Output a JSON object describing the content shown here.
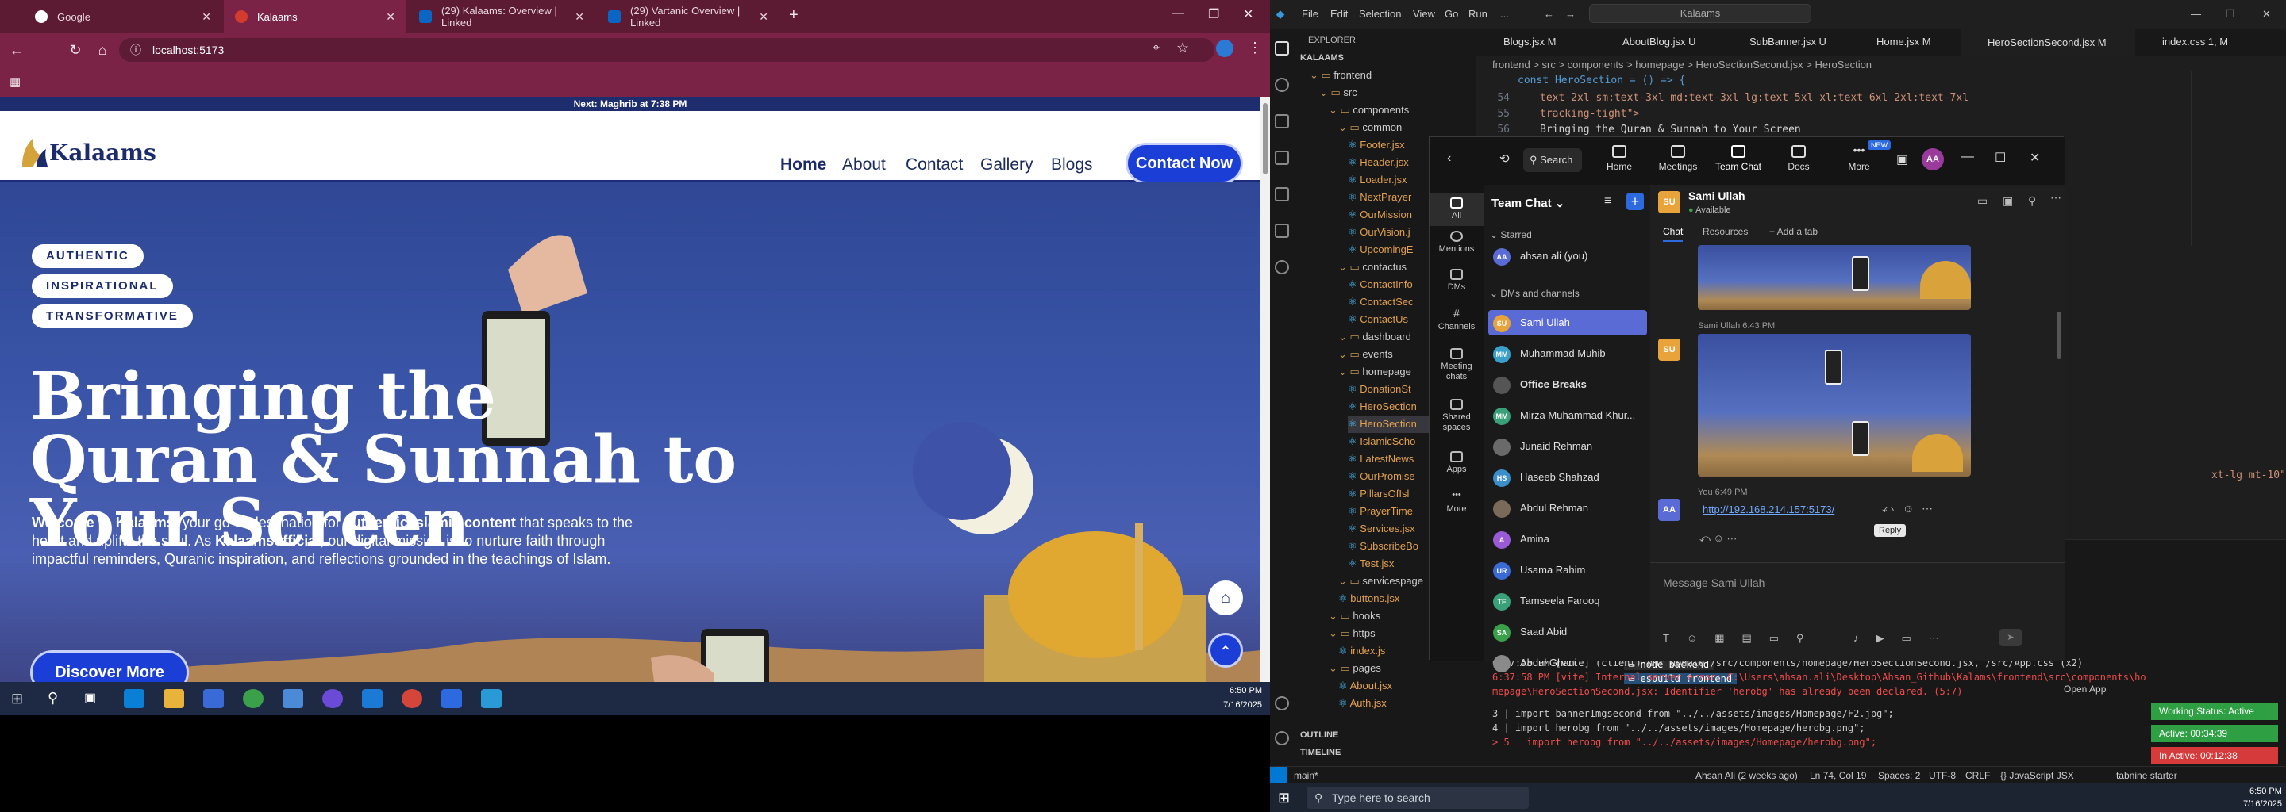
{
  "browser": {
    "tabs": [
      {
        "title": "Google",
        "color": "#ffffff"
      },
      {
        "title": "Kalaams",
        "color": "#d33b2c"
      },
      {
        "title": "(29) Kalaams: Overview | Linked",
        "color": "#0a66c2"
      },
      {
        "title": "(29) Vartanic Overview | Linked",
        "color": "#0a66c2"
      }
    ],
    "url": "localhost:5173",
    "taskbar_time": "6:50 PM",
    "taskbar_date": "7/16/2025"
  },
  "site": {
    "prayer_banner": "Next: Maghrib at 7:38 PM",
    "logo": "Kalaams",
    "nav": [
      "Home",
      "About",
      "Contact",
      "Gallery",
      "Blogs"
    ],
    "cta": "Contact Now",
    "pills": [
      "AUTHENTIC",
      "INSPIRATIONAL",
      "TRANSFORMATIVE"
    ],
    "hero_title": "Bringing the Quran & Sunnah to Your Screen",
    "hero_desc_1": "Welcome to Kalaams",
    "hero_desc_2": ", your go-to destination for ",
    "hero_desc_3": "authentic Islamic content",
    "hero_desc_4": " that speaks to the heart and uplifts the soul. As ",
    "hero_desc_5": "Kalaamsofficial",
    "hero_desc_6": ", our digital mission is to nurture faith through impactful reminders, Quranic inspiration, and reflections grounded in the teachings of Islam.",
    "discover": "Discover More"
  },
  "vscode": {
    "menu": [
      "File",
      "Edit",
      "Selection",
      "View",
      "Go",
      "Run",
      "..."
    ],
    "search": "Kalaams",
    "explorer_title": "EXPLORER",
    "root": "KALAAMS",
    "tree": [
      {
        "name": "frontend",
        "type": "dir",
        "indent": 1
      },
      {
        "name": "src",
        "type": "dir",
        "indent": 2
      },
      {
        "name": "components",
        "type": "dir",
        "indent": 3
      },
      {
        "name": "common",
        "type": "dir",
        "indent": 4
      },
      {
        "name": "Footer.jsx",
        "type": "file",
        "indent": 5
      },
      {
        "name": "Header.jsx",
        "type": "file",
        "indent": 5
      },
      {
        "name": "Loader.jsx",
        "type": "file",
        "indent": 5
      },
      {
        "name": "NextPrayer",
        "type": "file",
        "indent": 5
      },
      {
        "name": "OurMission",
        "type": "file",
        "indent": 5
      },
      {
        "name": "OurVision.j",
        "type": "file",
        "indent": 5
      },
      {
        "name": "UpcomingE",
        "type": "file",
        "indent": 5
      },
      {
        "name": "contactus",
        "type": "dir",
        "indent": 4
      },
      {
        "name": "ContactInfo",
        "type": "file",
        "indent": 5
      },
      {
        "name": "ContactSec",
        "type": "file",
        "indent": 5
      },
      {
        "name": "ContactUs",
        "type": "file",
        "indent": 5
      },
      {
        "name": "dashboard",
        "type": "dir",
        "indent": 4
      },
      {
        "name": "events",
        "type": "dir",
        "indent": 4
      },
      {
        "name": "homepage",
        "type": "dir",
        "indent": 4
      },
      {
        "name": "DonationSt",
        "type": "file",
        "indent": 5
      },
      {
        "name": "HeroSection",
        "type": "file",
        "indent": 5
      },
      {
        "name": "HeroSection",
        "type": "file",
        "indent": 5
      },
      {
        "name": "IslamicScho",
        "type": "file",
        "indent": 5
      },
      {
        "name": "LatestNews",
        "type": "file",
        "indent": 5
      },
      {
        "name": "OurPromise",
        "type": "file",
        "indent": 5
      },
      {
        "name": "PillarsOfIsl",
        "type": "file",
        "indent": 5
      },
      {
        "name": "PrayerTime",
        "type": "file",
        "indent": 5
      },
      {
        "name": "Services.jsx",
        "type": "file",
        "indent": 5
      },
      {
        "name": "SubscribeBo",
        "type": "file",
        "indent": 5
      },
      {
        "name": "Test.jsx",
        "type": "file",
        "indent": 5
      },
      {
        "name": "servicespage",
        "type": "dir",
        "indent": 4
      },
      {
        "name": "buttons.jsx",
        "type": "file",
        "indent": 4
      },
      {
        "name": "hooks",
        "type": "dir",
        "indent": 3
      },
      {
        "name": "https",
        "type": "dir",
        "indent": 3
      },
      {
        "name": "index.js",
        "type": "file",
        "indent": 4
      },
      {
        "name": "pages",
        "type": "dir",
        "indent": 3
      },
      {
        "name": "About.jsx",
        "type": "file",
        "indent": 4
      },
      {
        "name": "Auth.jsx",
        "type": "file",
        "indent": 4
      }
    ],
    "outline": "OUTLINE",
    "timeline": "TIMELINE",
    "editor_tabs": [
      "Blogs.jsx M",
      "AboutBlog.jsx U",
      "SubBanner.jsx U",
      "Home.jsx M",
      "HeroSectionSecond.jsx M",
      "index.css 1, M"
    ],
    "breadcrumb": "frontend > src > components > homepage > HeroSectionSecond.jsx > HeroSection",
    "code_sticky": "const HeroSection = () => {",
    "code_lines": [
      {
        "n": "54",
        "t": "text-2xl sm:text-3xl md:text-3xl lg:text-5xl xl:text-6xl 2xl:text-7xl"
      },
      {
        "n": "55",
        "t": "  tracking-tight\">"
      },
      {
        "n": "56",
        "t": "  Bringing the Quran & Sunnah to Your Screen"
      }
    ],
    "code_fragment": "xt-lg mt-10\"",
    "terminal": [
      {
        "t": "6:37:58 PM [vite] (client) hmr update /src/components/homepage/HeroSectionSecond.jsx, /src/App.css (x2)",
        "c": "#cccccc"
      },
      {
        "t": "6:37:58 PM [vite] Internal server error: C:\\Users\\ahsan.ali\\Desktop\\Ahsan_Github\\Kalams\\frontend\\src\\components\\ho",
        "c": "#f14c4c"
      },
      {
        "t": "mepage\\HeroSectionSecond.jsx: Identifier 'herobg' has already been declared. (5:7)",
        "c": "#f14c4c"
      },
      {
        "t": "  3 | import bannerImgsecond from \"../../assets/images/Homepage/F2.jpg\";",
        "c": "#cccccc"
      },
      {
        "t": "  4 | import herobg from \"../../assets/images/Homepage/herobg.png\";",
        "c": "#cccccc"
      },
      {
        "t": "> 5 | import herobg from \"../../assets/images/Homepage/herobg.png\";",
        "c": "#f14c4c"
      }
    ],
    "term_tabs": [
      "node backend",
      "esbuild frontend"
    ],
    "open_app": "Open App",
    "working_status": "Working Status: Active",
    "active_time": "Active: 00:34:39",
    "inactive_time": "In Active: 00:12:38",
    "status_left": "main*",
    "status_items": [
      "Ahsan Ali (2 weeks ago)",
      "Ln 74, Col 19",
      "Spaces: 2",
      "UTF-8",
      "CRLF",
      "{} JavaScript JSX",
      "tabnine starter"
    ],
    "taskbar_search": "Type here to search",
    "taskbar_time": "6:50 PM",
    "taskbar_date": "7/16/2025"
  },
  "teams": {
    "top_search": "Search",
    "top_nav": [
      "Home",
      "Meetings",
      "Team Chat",
      "Docs",
      "More"
    ],
    "new_badge": "NEW",
    "rail": [
      "All",
      "Mentions",
      "DMs",
      "Channels",
      "Meeting chats",
      "Shared spaces",
      "Apps",
      "More"
    ],
    "list_title": "Team Chat",
    "starred_label": "Starred",
    "dms_label": "DMs and channels",
    "people": [
      {
        "initials": "AA",
        "name": "ahsan ali (you)",
        "color": "#5a6bd6",
        "group": "starred"
      },
      {
        "initials": "SU",
        "name": "Sami Ullah",
        "color": "#e8a33b",
        "group": "dm",
        "sel": true
      },
      {
        "initials": "MM",
        "name": "Muhammad Muhib",
        "color": "#3aa0c9",
        "group": "dm"
      },
      {
        "initials": "",
        "name": "Office Breaks",
        "color": "#555555",
        "group": "dm",
        "bold": true
      },
      {
        "initials": "MM",
        "name": "Mirza Muhammad Khur...",
        "color": "#3aa07a",
        "group": "dm"
      },
      {
        "initials": "",
        "name": "Junaid Rehman",
        "color": "#6a6a6a",
        "group": "dm"
      },
      {
        "initials": "HS",
        "name": "Haseeb Shahzad",
        "color": "#3a8fc9",
        "group": "dm"
      },
      {
        "initials": "",
        "name": "Abdul Rehman",
        "color": "#7a6a5a",
        "group": "dm"
      },
      {
        "initials": "A",
        "name": "Amina",
        "color": "#9a5ad6",
        "group": "dm"
      },
      {
        "initials": "UR",
        "name": "Usama Rahim",
        "color": "#3a6ad6",
        "group": "dm"
      },
      {
        "initials": "TF",
        "name": "Tamseela Farooq",
        "color": "#3aa07a",
        "group": "dm"
      },
      {
        "initials": "SA",
        "name": "Saad Abid",
        "color": "#3aa04a",
        "group": "dm"
      },
      {
        "initials": "",
        "name": "Abdul Ghani",
        "color": "#8a8a8a",
        "group": "dm"
      }
    ],
    "conv_name": "Sami Ullah",
    "conv_status": "Available",
    "conv_initials": "SU",
    "conv_tabs": [
      "Chat",
      "Resources",
      "+ Add a tab"
    ],
    "msg1_meta": "Sami Ullah 6:43 PM",
    "msg2_meta": "You 6:49 PM",
    "msg2_initials": "AA",
    "msg2_link": "http://192.168.214.157:5173/",
    "tooltip": "Reply",
    "composer_placeholder": "Message Sami Ullah"
  }
}
